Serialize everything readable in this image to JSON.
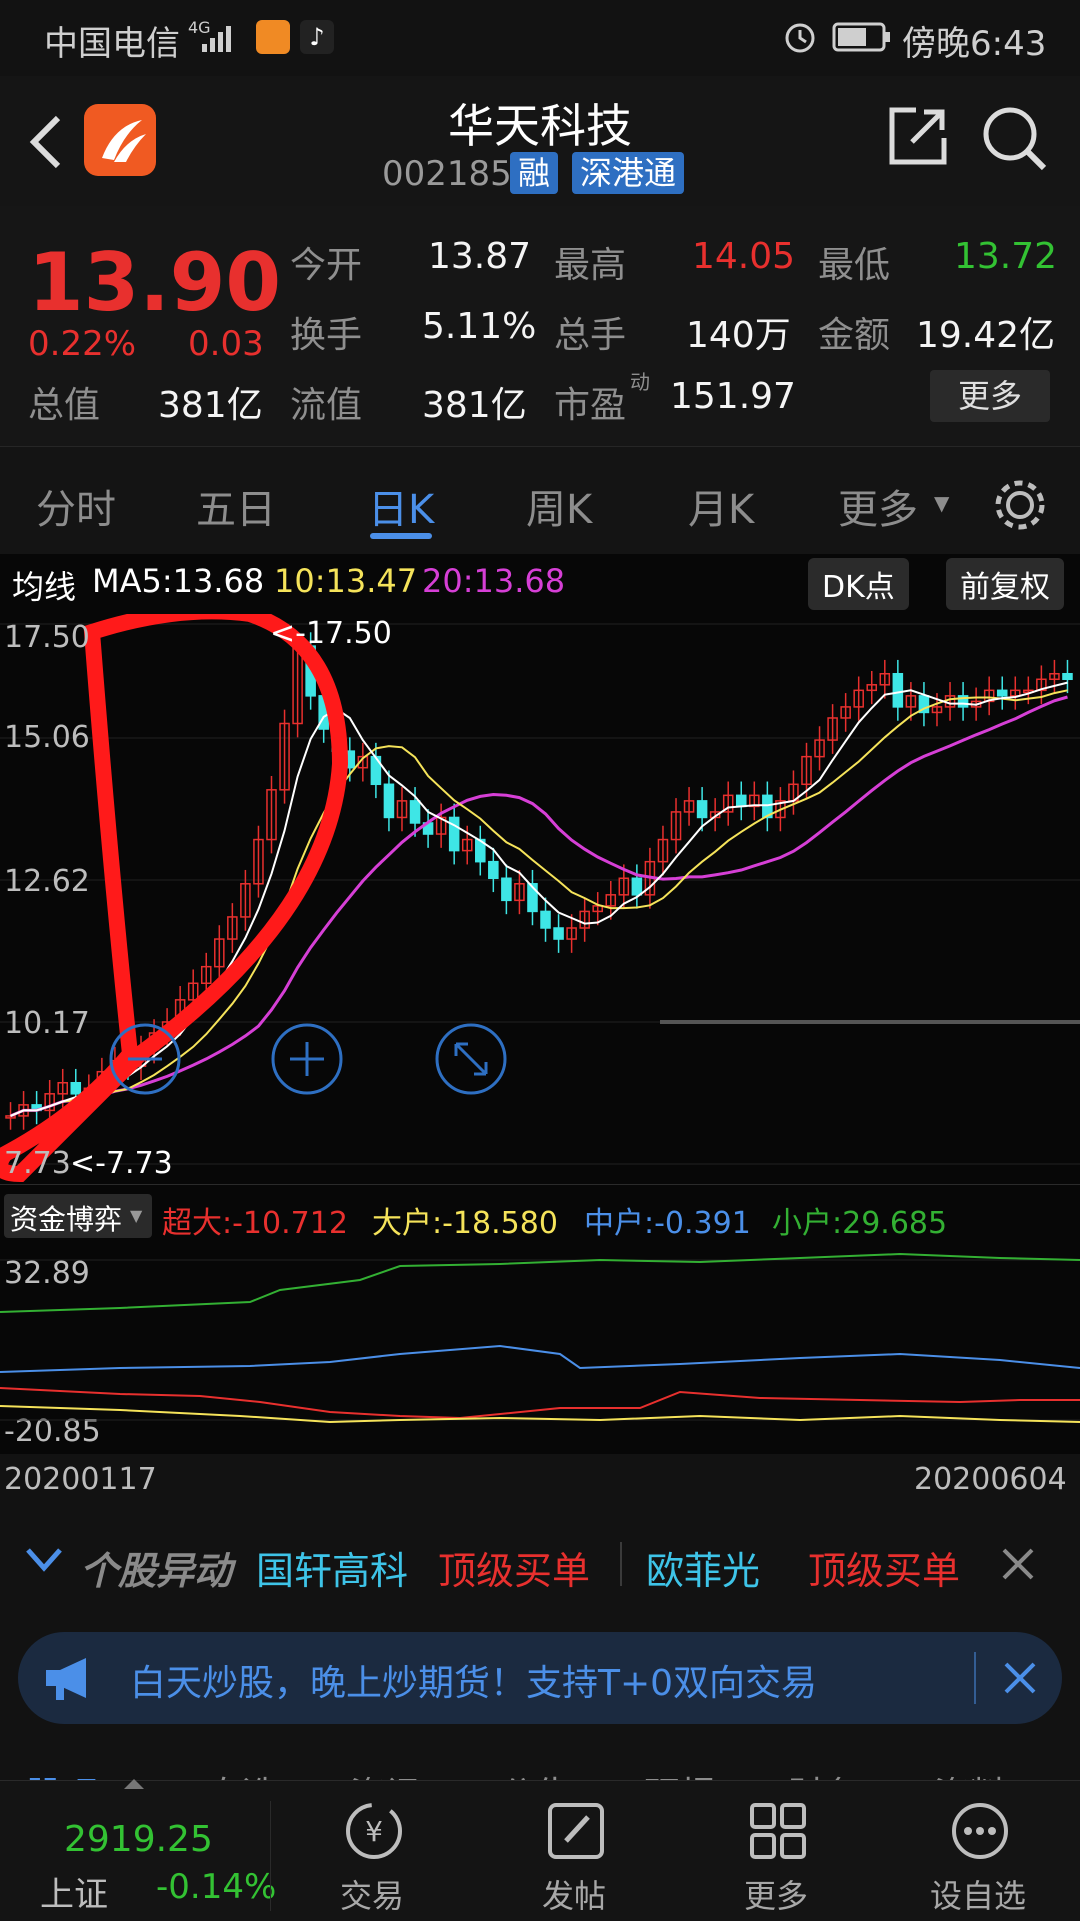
{
  "status_bar": {
    "carrier": "中国电信",
    "network": "4G",
    "time": "傍晚6:43"
  },
  "header": {
    "title": "华天科技",
    "code": "002185",
    "tags": [
      "融",
      "深港通"
    ]
  },
  "quote": {
    "price": "13.90",
    "change_pct": "0.22%",
    "change": "0.03",
    "total_value_label": "总值",
    "total_value": "381亿",
    "fields": [
      {
        "label": "今开",
        "value": "13.87"
      },
      {
        "label": "最高",
        "value": "14.05"
      },
      {
        "label": "最低",
        "value": "13.72"
      },
      {
        "label": "换手",
        "value": "5.11%"
      },
      {
        "label": "总手",
        "value": "140万"
      },
      {
        "label": "金额",
        "value": "19.42亿"
      },
      {
        "label": "流值",
        "value": "381亿"
      },
      {
        "label": "市盈",
        "value": "151.97"
      }
    ],
    "pe_superscript": "动",
    "more_button": "更多"
  },
  "tabs": [
    "分时",
    "五日",
    "日K",
    "周K",
    "月K",
    "更多"
  ],
  "active_tab": "日K",
  "chart": {
    "ma_label": "均线",
    "ma5": "MA5:13.68",
    "ma10": "10:13.47",
    "ma20": "20:13.68",
    "dk_button": "DK点",
    "adjust_button": "前复权",
    "y_labels": [
      "17.50",
      "15.06",
      "12.62",
      "10.17",
      "7.73"
    ],
    "high_marker": "<-17.50",
    "low_marker": "<-7.73",
    "colors": {
      "ma5": "#ffffff",
      "ma10": "#f5e35a",
      "ma20": "#d63fd6",
      "up": "#e8302e",
      "down": "#3ee6e6"
    }
  },
  "fund_panel": {
    "selector": "资金博弈",
    "items": [
      {
        "label": "超大:-10.712",
        "color": "#e8302e"
      },
      {
        "label": "大户:-18.580",
        "color": "#f5e35a"
      },
      {
        "label": "中户:-0.391",
        "color": "#4b8fe8"
      },
      {
        "label": "小户:29.685",
        "color": "#33b033"
      }
    ],
    "y_top": "32.89",
    "y_bottom": "-20.85",
    "date_start": "20200117",
    "date_end": "20200604"
  },
  "news": {
    "title": "个股异动",
    "items": [
      {
        "name": "国轩高科",
        "tag": "顶级买单"
      },
      {
        "name": "欧菲光",
        "tag": "顶级买单"
      }
    ]
  },
  "banner": {
    "text": "白天炒股，晚上炒期货！支持T+0双向交易"
  },
  "bottom_tabs_partial": [
    "股吧",
    "自选",
    "资讯",
    "公告",
    "研报",
    "财务",
    "资料"
  ],
  "bottom_nav": {
    "index_value": "2919.25",
    "index_name": "上证",
    "index_change": "-0.14%",
    "items": [
      "交易",
      "发帖",
      "更多",
      "设自选"
    ]
  }
}
